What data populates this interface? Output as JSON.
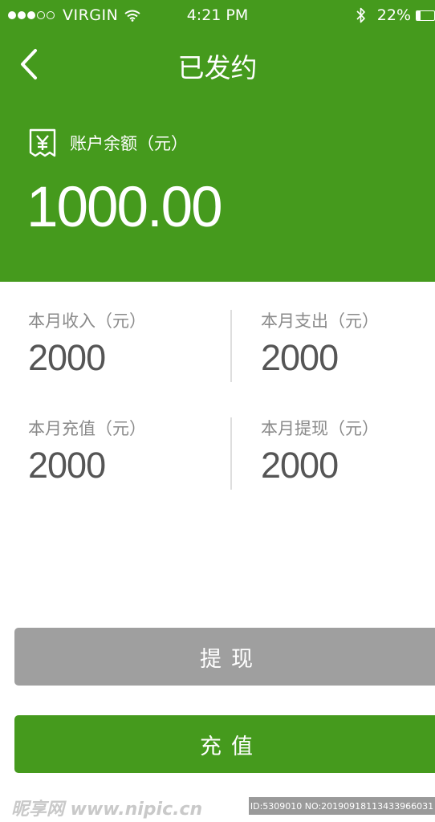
{
  "status_bar": {
    "carrier": "VIRGIN",
    "time": "4:21 PM",
    "battery_text": "22%",
    "battery_level": 0.22,
    "signal_bars_filled": 3,
    "signal_bars_total": 5
  },
  "nav": {
    "title": "已发约",
    "back_icon": "chevron-left-icon"
  },
  "balance": {
    "icon": "receipt-yen-icon",
    "label": "账户余额（元）",
    "value": "1000.00"
  },
  "stats": [
    {
      "label": "本月收入（元）",
      "value": "2000"
    },
    {
      "label": "本月支出（元）",
      "value": "2000"
    },
    {
      "label": "本月充值（元）",
      "value": "2000"
    },
    {
      "label": "本月提现（元）",
      "value": "2000"
    }
  ],
  "buttons": {
    "withdraw": "提现",
    "recharge": "充值"
  },
  "watermark": {
    "left": "昵享网 www.nipic.cn",
    "right": "ID:5309010 NO:20190918113433966031"
  },
  "colors": {
    "primary_green": "#459a1d",
    "disabled_gray": "#9f9f9f",
    "label_gray": "#8a8a8a",
    "value_gray": "#555555"
  }
}
